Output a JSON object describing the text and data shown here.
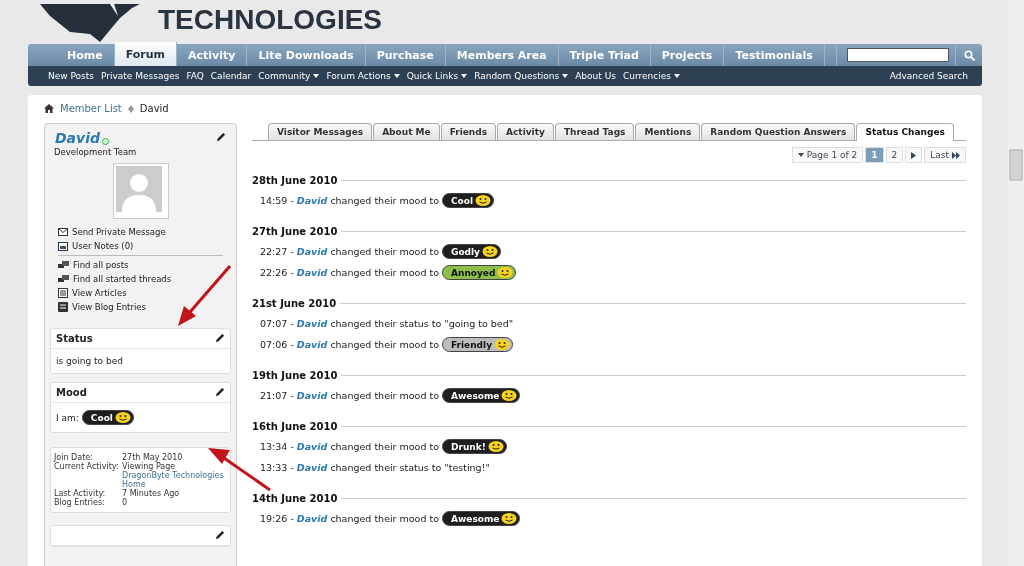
{
  "logo": {
    "text": "TECHNOLOGIES"
  },
  "nav": {
    "tabs": [
      {
        "label": "Home",
        "selected": false
      },
      {
        "label": "Forum",
        "selected": true
      },
      {
        "label": "Activity",
        "selected": false
      },
      {
        "label": "Lite Downloads",
        "selected": false
      },
      {
        "label": "Purchase",
        "selected": false
      },
      {
        "label": "Members Area",
        "selected": false
      },
      {
        "label": "Triple Triad",
        "selected": false
      },
      {
        "label": "Projects",
        "selected": false
      },
      {
        "label": "Testimonials",
        "selected": false
      }
    ],
    "sublinks": [
      {
        "label": "New Posts",
        "dropdown": false
      },
      {
        "label": "Private Messages",
        "dropdown": false
      },
      {
        "label": "FAQ",
        "dropdown": false
      },
      {
        "label": "Calendar",
        "dropdown": false
      },
      {
        "label": "Community",
        "dropdown": true
      },
      {
        "label": "Forum Actions",
        "dropdown": true
      },
      {
        "label": "Quick Links",
        "dropdown": true
      },
      {
        "label": "Random Questions",
        "dropdown": true
      },
      {
        "label": "About Us",
        "dropdown": false
      },
      {
        "label": "Currencies",
        "dropdown": true
      }
    ],
    "advanced_search": "Advanced Search"
  },
  "breadcrumb": [
    "Member List",
    "David"
  ],
  "profile": {
    "name": "David",
    "online": true,
    "title": "Development Team",
    "links": [
      {
        "label": "Send Private Message",
        "kind": "mail"
      },
      {
        "label": "User Notes (0)",
        "kind": "notes"
      },
      {
        "label": "Find all posts",
        "kind": "posts"
      },
      {
        "label": "Find all started threads",
        "kind": "posts"
      },
      {
        "label": "View Articles",
        "kind": "articles"
      },
      {
        "label": "View Blog Entries",
        "kind": "blog"
      }
    ]
  },
  "status_box": {
    "title": "Status",
    "text": "is going to bed"
  },
  "mood_box": {
    "title": "Mood",
    "prefix": "I am:",
    "mood": {
      "label": "Cool",
      "color": "#1e1e1e"
    }
  },
  "info": [
    {
      "label": "Join Date:",
      "value": "27th May 2010"
    },
    {
      "label": "Current Activity:",
      "value": "Viewing Page",
      "link": "DragonByte Technologies Home"
    },
    {
      "label": "Last Activity:",
      "value": "7 Minutes Ago"
    },
    {
      "label": "Blog Entries:",
      "value": "0"
    }
  ],
  "profile_tabs": [
    {
      "label": "Visitor Messages",
      "selected": false
    },
    {
      "label": "About Me",
      "selected": false
    },
    {
      "label": "Friends",
      "selected": false
    },
    {
      "label": "Activity",
      "selected": false
    },
    {
      "label": "Thread Tags",
      "selected": false
    },
    {
      "label": "Mentions",
      "selected": false
    },
    {
      "label": "Random Question Answers",
      "selected": false
    },
    {
      "label": "Status Changes",
      "selected": true
    }
  ],
  "pagination": {
    "label": "Page 1 of 2",
    "pages": [
      {
        "label": "1",
        "selected": true
      },
      {
        "label": "2",
        "selected": false
      }
    ],
    "last": "Last"
  },
  "days": [
    {
      "date": "28th June 2010",
      "entries": [
        {
          "kind": "mood",
          "time": "14:59 -",
          "user": "David",
          "action": "changed their mood to",
          "mood": {
            "label": "Cool",
            "color": "#1e1e1e"
          }
        }
      ]
    },
    {
      "date": "27th June 2010",
      "entries": [
        {
          "kind": "mood",
          "time": "22:27 -",
          "user": "David",
          "action": "changed their mood to",
          "mood": {
            "label": "Godly",
            "color": "#1e1e1e"
          }
        },
        {
          "kind": "mood",
          "time": "22:26 -",
          "user": "David",
          "action": "changed their mood to",
          "mood": {
            "label": "Annoyed",
            "color": "#8fbf4a"
          }
        }
      ]
    },
    {
      "date": "21st June 2010",
      "entries": [
        {
          "kind": "status",
          "time": "07:07 -",
          "user": "David",
          "action": "changed their status to \"going to bed\""
        },
        {
          "kind": "mood",
          "time": "07:06 -",
          "user": "David",
          "action": "changed their mood to",
          "mood": {
            "label": "Friendly",
            "color": "#bdbdbd"
          }
        }
      ]
    },
    {
      "date": "19th June 2010",
      "entries": [
        {
          "kind": "mood",
          "time": "21:07 -",
          "user": "David",
          "action": "changed their mood to",
          "mood": {
            "label": "Awesome",
            "color": "#1e1e1e"
          }
        }
      ]
    },
    {
      "date": "16th June 2010",
      "entries": [
        {
          "kind": "mood",
          "time": "13:34 -",
          "user": "David",
          "action": "changed their mood to",
          "mood": {
            "label": "Drunk!",
            "color": "#1e1e1e"
          }
        },
        {
          "kind": "status",
          "time": "13:33 -",
          "user": "David",
          "action": "changed their status to \"testing!\""
        }
      ]
    },
    {
      "date": "14th June 2010",
      "entries": [
        {
          "kind": "mood",
          "time": "19:26 -",
          "user": "David",
          "action": "changed their mood to",
          "mood": {
            "label": "Awesome",
            "color": "#1e1e1e"
          }
        }
      ]
    }
  ]
}
